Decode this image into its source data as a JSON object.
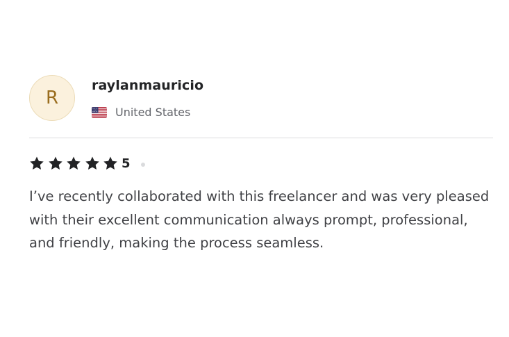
{
  "reviewer": {
    "initial": "R",
    "username": "raylanmauricio",
    "country": "United States",
    "flag_icon": "us-flag-icon"
  },
  "rating": {
    "stars": 5,
    "max_stars": 5,
    "value_label": "5",
    "star_icon": "star-icon",
    "star_color": "#222325"
  },
  "review": {
    "text": "I’ve recently collaborated with this freelancer and was very pleased with their excellent communication always prompt, professional, and friendly, making the process seamless."
  },
  "colors": {
    "avatar_bg": "#fbf1dd",
    "avatar_text": "#9a6d1e",
    "text_primary": "#222325",
    "text_secondary": "#62646a",
    "divider": "#dadbdd"
  }
}
